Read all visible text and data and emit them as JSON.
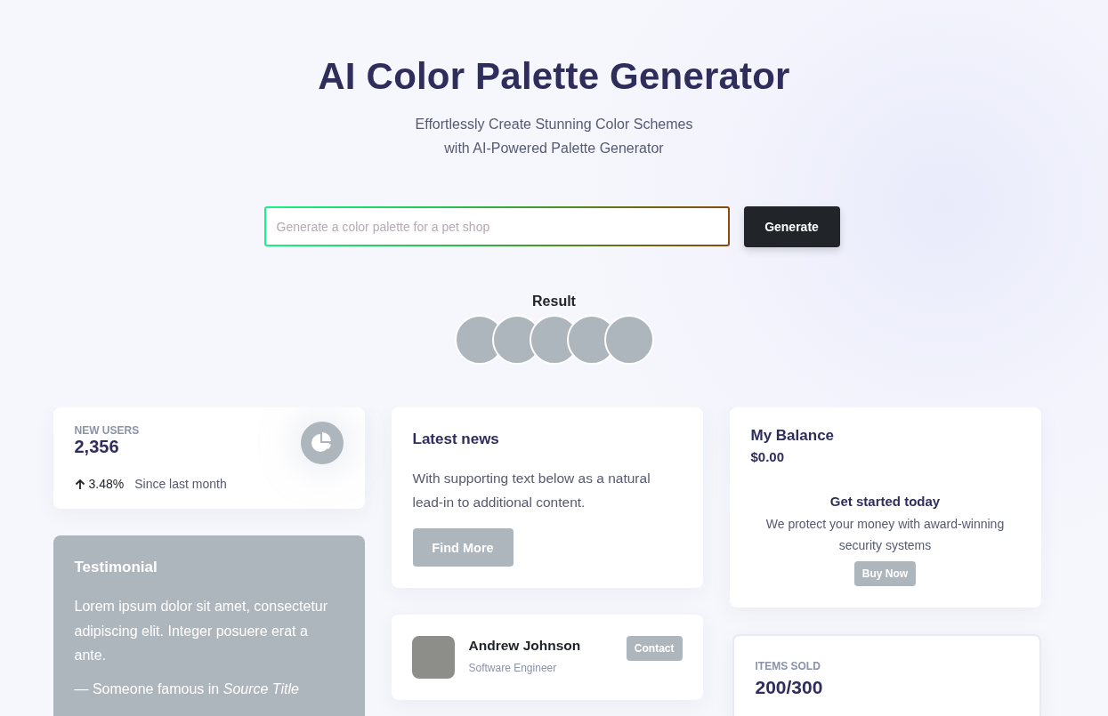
{
  "header": {
    "title": "AI Color Palette Generator",
    "subtitle_lines": [
      "Effortlessly Create Stunning Color Schemes",
      "with AI-Powered Palette Generator"
    ]
  },
  "prompt": {
    "placeholder": "Generate a color palette for a pet shop",
    "button": "Generate"
  },
  "result": {
    "label": "Result",
    "swatches": [
      {
        "color": "#adb5bd"
      },
      {
        "color": "#adb5bd"
      },
      {
        "color": "#adb5bd"
      },
      {
        "color": "#adb5bd"
      },
      {
        "color": "#adb5bd"
      }
    ]
  },
  "new_users": {
    "label": "NEW USERS",
    "value": "2,356",
    "change": "3.48%",
    "period": "Since last month"
  },
  "testimonial": {
    "title": "Testimonial",
    "text": "Lorem ipsum dolor sit amet, consectetur adipiscing elit. Integer posuere erat a ante.",
    "source": "— Someone famous in *Source Title*"
  },
  "news": {
    "title": "Latest news",
    "text": "With supporting text below as a natural lead-in to additional content.",
    "button": "Find More"
  },
  "profile": {
    "name": "Andrew Johnson",
    "role": "Software Engineer",
    "button": "Contact"
  },
  "balance": {
    "title": "My Balance",
    "amount": "$0.00",
    "heading": "Get started today",
    "text": "We protect your money with award-winning security systems",
    "button": "Buy Now"
  },
  "items_sold": {
    "label": "ITEMS SOLD",
    "value": "200/300"
  }
}
